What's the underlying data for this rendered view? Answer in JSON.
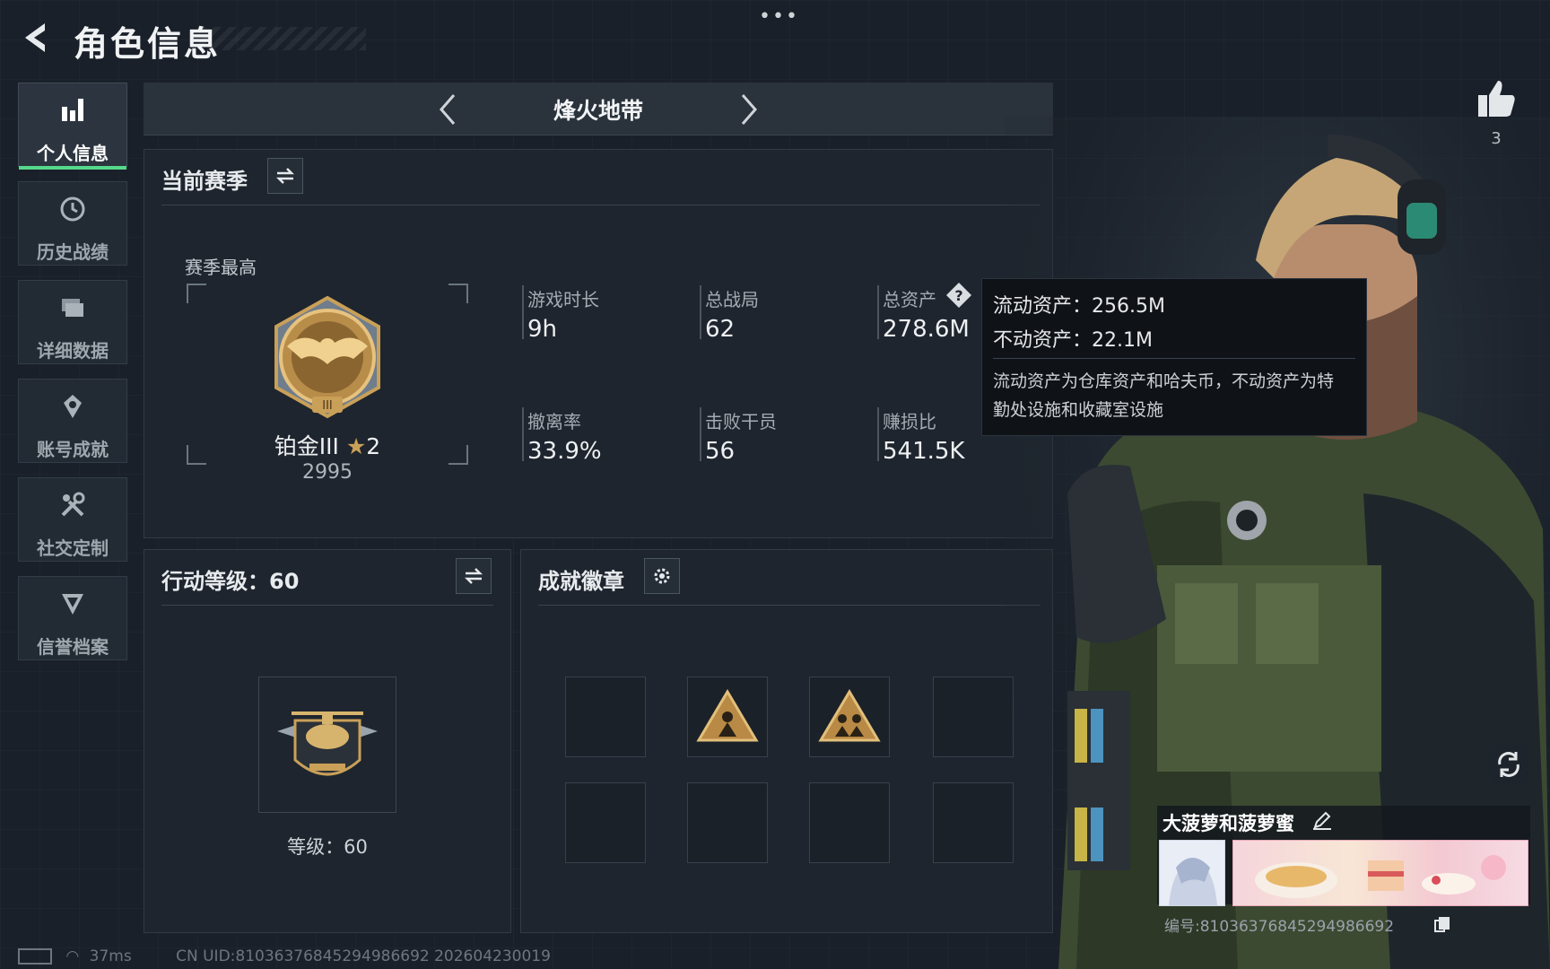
{
  "header": {
    "title": "角色信息",
    "menu": "•••"
  },
  "sidebar": {
    "items": [
      {
        "label": "个人信息",
        "icon": "bar-chart-icon",
        "active": true
      },
      {
        "label": "历史战绩",
        "icon": "history-icon",
        "active": false
      },
      {
        "label": "详细数据",
        "icon": "folder-icon",
        "active": false
      },
      {
        "label": "账号成就",
        "icon": "achievement-icon",
        "active": false
      },
      {
        "label": "社交定制",
        "icon": "tools-icon",
        "active": false
      },
      {
        "label": "信誉档案",
        "icon": "credit-icon",
        "active": false
      }
    ]
  },
  "mode": {
    "title": "烽火地带"
  },
  "season": {
    "header": "当前赛季",
    "best_label": "赛季最高",
    "rank": {
      "name": "铂金III",
      "stars": "2",
      "points": "2995"
    },
    "stats": [
      {
        "label": "游戏时长",
        "value": "9h"
      },
      {
        "label": "总战局",
        "value": "62"
      },
      {
        "label": "总资产",
        "value": "278.6M"
      },
      {
        "label": "撤离率",
        "value": "33.9%"
      },
      {
        "label": "击败干员",
        "value": "56"
      },
      {
        "label": "赚损比",
        "value": "541.5K"
      }
    ]
  },
  "tooltip": {
    "liquid": "流动资产：256.5M",
    "fixed": "不动资产：22.1M",
    "desc": "流动资产为仓库资产和哈夫币，不动资产为特勤处设施和收藏室设施"
  },
  "level": {
    "header": "行动等级：60",
    "label": "等级：60"
  },
  "badges": {
    "header": "成就徽章",
    "slots": [
      false,
      true,
      true,
      false,
      false,
      false,
      false,
      false
    ]
  },
  "profile": {
    "likes": "3",
    "player_name": "大菠萝和菠萝蜜",
    "card_uid": "编号:8103637684529498669​2"
  },
  "footer": {
    "ping": "37ms",
    "uid": "CN UID:8103637684529498669​2 202604230019"
  },
  "colors": {
    "accent": "#56d88b",
    "gold": "#c9a058"
  }
}
